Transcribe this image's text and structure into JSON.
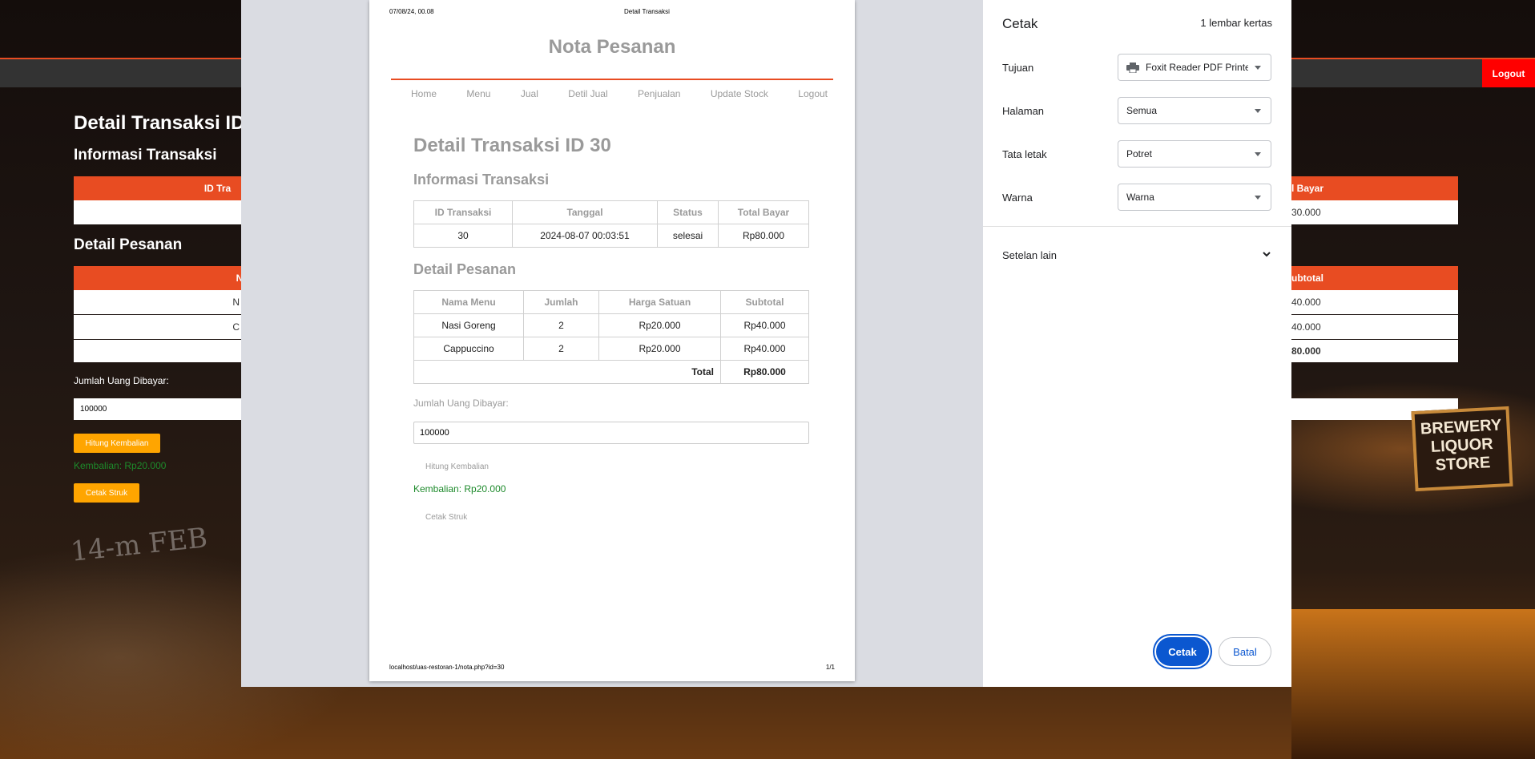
{
  "background_app": {
    "logout": "Logout",
    "title_partial": "Detail Transaksi ID",
    "info_heading": "Informasi Transaksi",
    "pesanan_heading": "Detail Pesanan",
    "col_left_partial": "ID Tra",
    "col_right_partial": "l Bayar",
    "right_cell_partial": "30.000",
    "sub_header_left": "N",
    "sub_header_right": "ubtotal",
    "rows_left": [
      "N",
      "C"
    ],
    "rows_right": [
      "40.000",
      "40.000",
      "80.000"
    ],
    "pay_label": "Jumlah Uang Dibayar:",
    "pay_value": "100000",
    "hitung_button": "Hitung Kembalian",
    "kembalian": "Kembalian: Rp20.000",
    "cetak_button": "Cetak Struk",
    "sign_text": "BREWERY LIQUOR STORE",
    "scribble": "14-m FEB"
  },
  "page_header": {
    "datetime": "07/08/24, 00.08",
    "doc_title": "Detail Transaksi"
  },
  "nota": {
    "title": "Nota Pesanan",
    "nav": [
      "Home",
      "Menu",
      "Jual",
      "Detil Jual",
      "Penjualan",
      "Update Stock",
      "Logout"
    ],
    "heading": "Detail Transaksi ID 30",
    "info_heading": "Informasi Transaksi",
    "info_table": {
      "headers": [
        "ID Transaksi",
        "Tanggal",
        "Status",
        "Total Bayar"
      ],
      "row": [
        "30",
        "2024-08-07 00:03:51",
        "selesai",
        "Rp80.000"
      ]
    },
    "pesanan_heading": "Detail Pesanan",
    "pesanan_table": {
      "headers": [
        "Nama Menu",
        "Jumlah",
        "Harga Satuan",
        "Subtotal"
      ],
      "rows": [
        [
          "Nasi Goreng",
          "2",
          "Rp20.000",
          "Rp40.000"
        ],
        [
          "Cappuccino",
          "2",
          "Rp20.000",
          "Rp40.000"
        ]
      ],
      "total_label": "Total",
      "total_value": "Rp80.000"
    },
    "pay_label": "Jumlah Uang Dibayar:",
    "pay_value": "100000",
    "hitung_button": "Hitung Kembalian",
    "kembalian": "Kembalian: Rp20.000",
    "cetak_button": "Cetak Struk"
  },
  "page_footer": {
    "url": "localhost/uas-restoran-1/nota.php?id=30",
    "page_count": "1/1"
  },
  "print_settings": {
    "title": "Cetak",
    "sheets": "1 lembar kertas",
    "destination_label": "Tujuan",
    "destination_value": "Foxit Reader PDF Printer",
    "pages_label": "Halaman",
    "pages_value": "Semua",
    "layout_label": "Tata letak",
    "layout_value": "Potret",
    "color_label": "Warna",
    "color_value": "Warna",
    "more_settings": "Setelan lain",
    "print_button": "Cetak",
    "cancel_button": "Batal"
  },
  "colors": {
    "accent": "#e84c22",
    "primary_button": "#0b57d0",
    "success_text": "#1d8a2b",
    "warning_button": "#ffa500"
  }
}
